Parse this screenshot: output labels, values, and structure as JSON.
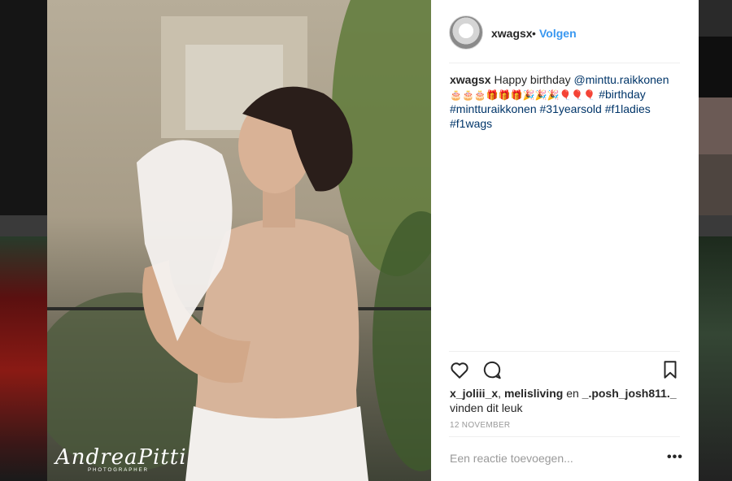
{
  "post": {
    "author": "xwagsx",
    "separator": "•",
    "follow_label": "Volgen",
    "avatar_text": "xwagsx",
    "caption": {
      "author": "xwagsx",
      "text": "Happy birthday",
      "mention": "@minttu.raikkonen",
      "emojis": "🎂🎂🎂🎁🎁🎁🎉🎉🎉🎈🎈🎈",
      "hashtags": [
        "#birthday",
        "#mintturaikkonen",
        "#31yearsold",
        "#f1ladies",
        "#f1wags"
      ]
    },
    "likes": {
      "user1": "x_joliii_x",
      "comma": ",",
      "user2": "melisliving",
      "and": "en",
      "user3": "_.posh_josh811._",
      "suffix": "vinden dit leuk"
    },
    "date": "12 NOVEMBER",
    "comment_placeholder": "Een reactie toevoegen...",
    "more_label": "•••"
  },
  "photo": {
    "watermark_name": "AndreaPitti",
    "watermark_sub": "PHOTOGRAPHER"
  },
  "icons": {
    "like": "heart-icon",
    "comment": "comment-bubble-icon",
    "save": "bookmark-icon"
  },
  "colors": {
    "link": "#003569",
    "follow": "#3897f0",
    "text": "#262626",
    "muted": "#999999"
  }
}
